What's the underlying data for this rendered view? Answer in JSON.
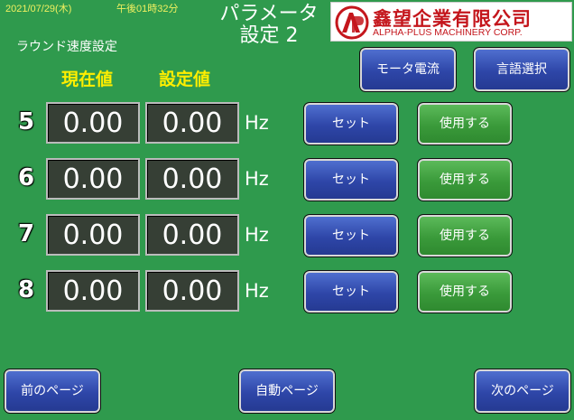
{
  "status": {
    "date": "2021/07/29(木)",
    "time": "午後01時32分"
  },
  "title": {
    "line1": "パラメータ",
    "line2": "設定 2"
  },
  "logo": {
    "name_cn": "鑫望企業有限公司",
    "name_en": "ALPHA-PLUS MACHINERY CORP.",
    "brand_color": "#c4161c"
  },
  "section_label": "ラウンド速度設定",
  "columns": {
    "current": "現在値",
    "setting": "設定値"
  },
  "header_buttons": {
    "motor_current": "モータ電流",
    "language": "言語選択"
  },
  "rows": [
    {
      "num": "5",
      "current": "0.00",
      "setting": "0.00",
      "unit": "Hz",
      "set_label": "セット",
      "use_label": "使用する"
    },
    {
      "num": "6",
      "current": "0.00",
      "setting": "0.00",
      "unit": "Hz",
      "set_label": "セット",
      "use_label": "使用する"
    },
    {
      "num": "7",
      "current": "0.00",
      "setting": "0.00",
      "unit": "Hz",
      "set_label": "セット",
      "use_label": "使用する"
    },
    {
      "num": "8",
      "current": "0.00",
      "setting": "0.00",
      "unit": "Hz",
      "set_label": "セット",
      "use_label": "使用する"
    }
  ],
  "footer": {
    "prev": "前のページ",
    "auto": "自動ページ",
    "next": "次のページ"
  },
  "colors": {
    "background": "#2f9a4d",
    "header_yellow": "#ffee00",
    "button_blue": "#2e46a8",
    "button_green": "#3a9a3a"
  }
}
